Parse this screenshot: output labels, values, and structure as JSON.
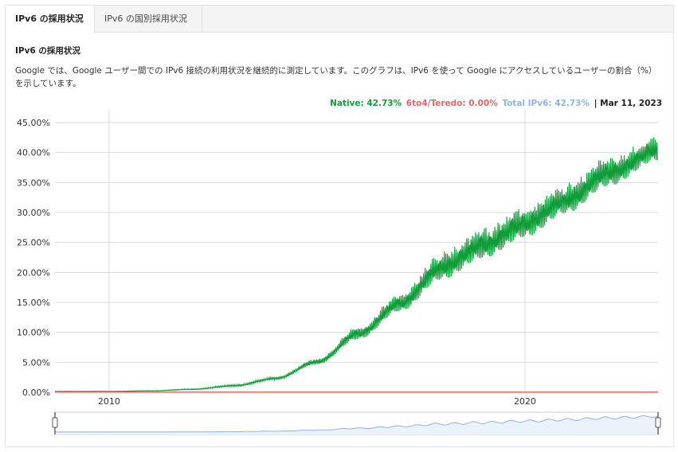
{
  "tabs": [
    {
      "label": "IPv6 の採用状況",
      "active": true
    },
    {
      "label": "IPv6 の国別採用状況",
      "active": false
    }
  ],
  "section_title": "IPv6 の採用状況",
  "description": "Google では、Google ユーザー間での IPv6 接続の利用状況を継続的に測定しています。このグラフは、IPv6 を使って Google にアクセスしているユーザーの割合（%）を示しています。",
  "legend": {
    "native": "Native: 42.73%",
    "teredo": "6to4/Teredo: 0.00%",
    "total": "Total IPv6: 42.73%",
    "date": "| Mar 11, 2023"
  },
  "colors": {
    "native": "#0f9d3a",
    "teredo": "#e06666",
    "total": "#8fb5e0",
    "grid": "#d9d9d9"
  },
  "chart_data": {
    "type": "area",
    "title": "",
    "xlabel": "",
    "ylabel": "",
    "xlim": [
      2008.7,
      2023.2
    ],
    "ylim": [
      0,
      45
    ],
    "y_ticks": [
      "0.00%",
      "5.00%",
      "10.00%",
      "15.00%",
      "20.00%",
      "25.00%",
      "30.00%",
      "35.00%",
      "40.00%",
      "45.00%"
    ],
    "x_ticks": [
      "2010",
      "2020"
    ],
    "x_tick_values": [
      2010,
      2020
    ],
    "grid": true,
    "series": [
      {
        "name": "Native",
        "x": [
          2008.7,
          2010,
          2011,
          2012,
          2013,
          2014,
          2015,
          2016,
          2017,
          2018,
          2019,
          2020,
          2021,
          2022,
          2023.2
        ],
        "low": [
          0.1,
          0.1,
          0.2,
          0.4,
          0.9,
          2.0,
          4.5,
          8.5,
          13.0,
          18.0,
          21.5,
          25.0,
          29.0,
          33.5,
          38.0
        ],
        "high": [
          0.2,
          0.2,
          0.3,
          0.6,
          1.3,
          2.6,
          5.6,
          11.0,
          16.5,
          23.5,
          27.5,
          31.0,
          35.0,
          39.5,
          42.7
        ]
      },
      {
        "name": "6to4/Teredo",
        "x": [
          2008.7,
          2023.2
        ],
        "values": [
          0.0,
          0.0
        ]
      }
    ]
  }
}
